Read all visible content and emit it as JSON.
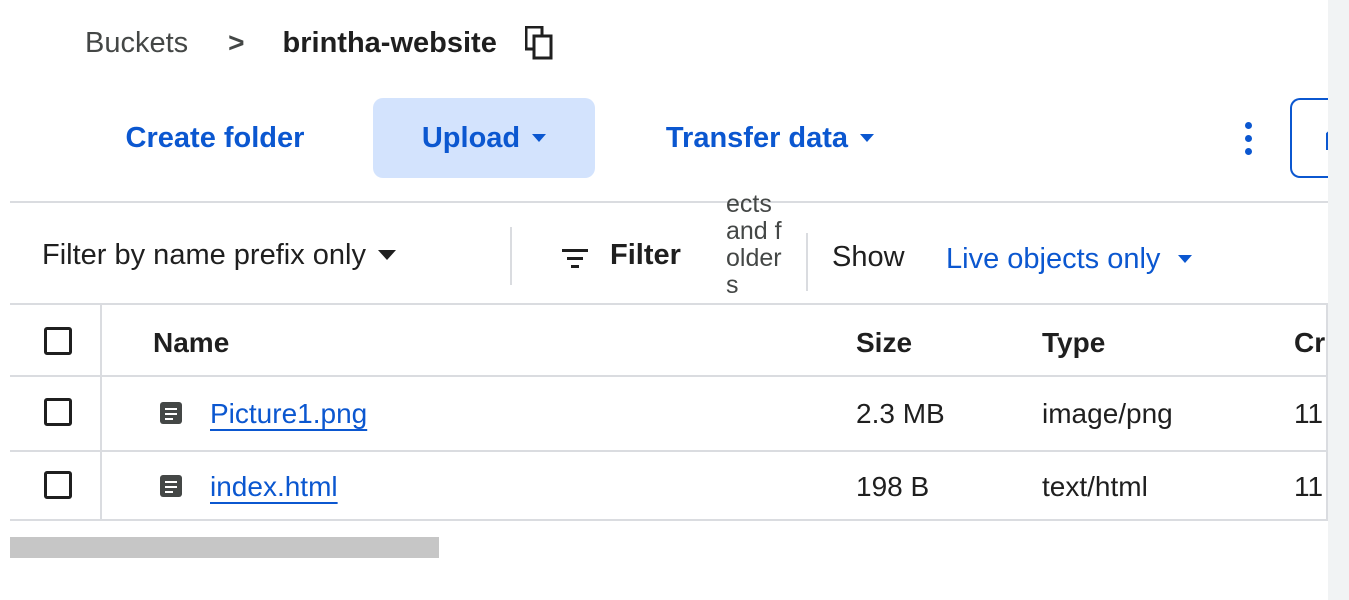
{
  "breadcrumb": {
    "root": "Buckets",
    "separator": ">",
    "current": "brintha-website"
  },
  "toolbar": {
    "create_folder": "Create folder",
    "upload": "Upload",
    "transfer_data": "Transfer data"
  },
  "filter_bar": {
    "prefix_dropdown": "Filter by name prefix only",
    "filter_label": "Filter",
    "wrapped_text": "ects and folders",
    "show_label": "Show",
    "show_value": "Live objects only"
  },
  "table": {
    "headers": {
      "name": "Name",
      "size": "Size",
      "type": "Type",
      "created": "Cr"
    },
    "rows": [
      {
        "name": "Picture1.png",
        "size": "2.3 MB",
        "type": "image/png",
        "created": "11"
      },
      {
        "name": "index.html",
        "size": "198 B",
        "type": "text/html",
        "created": "11"
      }
    ]
  },
  "colors": {
    "accent": "#0b57d0",
    "upload_bg": "#d3e3fd",
    "divider": "#dadce0",
    "text": "#1f1f1f",
    "muted": "#444746"
  },
  "icons": {
    "copy": "copy-icon",
    "kebab": "more-vert-icon",
    "filter": "filter-list-icon",
    "file": "file-icon"
  }
}
